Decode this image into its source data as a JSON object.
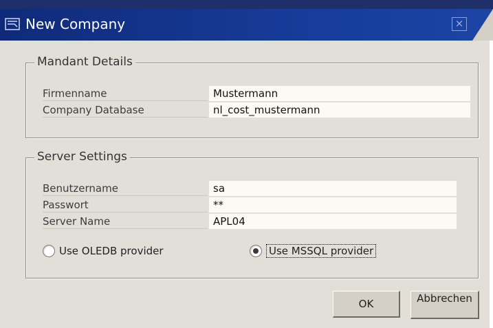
{
  "window": {
    "title": "New Company",
    "close_symbol": "×"
  },
  "mandant": {
    "legend": "Mandant Details",
    "fields": [
      {
        "label": "Firmenname",
        "value": "Mustermann"
      },
      {
        "label": "Company Database",
        "value": "nl_cost_mustermann"
      }
    ]
  },
  "server": {
    "legend": "Server Settings",
    "fields": [
      {
        "label": "Benutzername",
        "value": "sa"
      },
      {
        "label": "Passwort",
        "value": "**"
      },
      {
        "label": "Server Name",
        "value": "APL04"
      }
    ],
    "providers": [
      {
        "label": "Use OLEDB provider",
        "checked": false
      },
      {
        "label": "Use MSSQL provider",
        "checked": true
      }
    ]
  },
  "buttons": {
    "ok": "OK",
    "cancel": "Abbrechen"
  },
  "colors": {
    "titlebar": "#163a96",
    "client": "#e1dfd8",
    "input_bg": "#fbfbf3"
  }
}
